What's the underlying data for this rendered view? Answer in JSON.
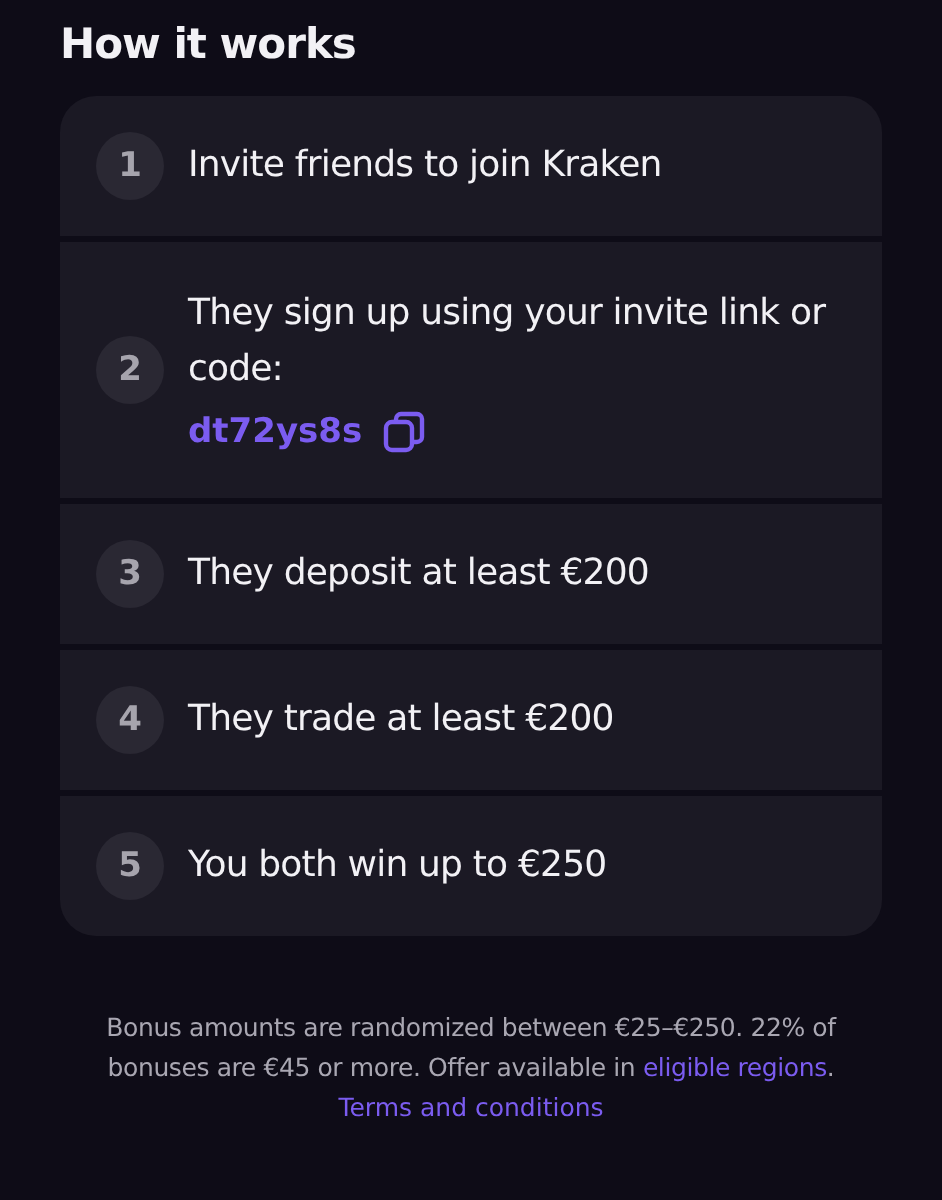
{
  "title": "How it works",
  "steps": [
    {
      "number": "1",
      "text": "Invite friends to join Kraken"
    },
    {
      "number": "2",
      "text": "They sign up using your invite link or code:",
      "code": "dt72ys8s"
    },
    {
      "number": "3",
      "text": "They deposit at least €200"
    },
    {
      "number": "4",
      "text": "They trade at least €200"
    },
    {
      "number": "5",
      "text": "You both win up to €250"
    }
  ],
  "footer": {
    "text": "Bonus amounts are randomized between €25–€250. 22% of bonuses are €45 or more. Offer available in",
    "link": "eligible regions",
    "after": ".",
    "terms": "Terms and conditions"
  }
}
